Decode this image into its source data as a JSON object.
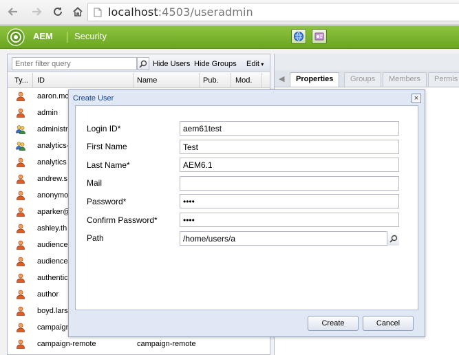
{
  "browser": {
    "url_host": "localhost",
    "url_rest": ":4503/useradmin"
  },
  "header": {
    "product": "AEM",
    "section": "Security"
  },
  "toolbar": {
    "filter_placeholder": "Enter filter query",
    "hide_users": "Hide Users",
    "hide_groups": "Hide Groups",
    "edit": "Edit"
  },
  "columns": {
    "type": "Ty...",
    "id": "ID",
    "name": "Name",
    "pub": "Pub.",
    "mod": "Mod."
  },
  "users": [
    {
      "id": "aaron.mc",
      "name": "",
      "kind": "user"
    },
    {
      "id": "admin",
      "name": "",
      "kind": "user"
    },
    {
      "id": "administr",
      "name": "",
      "kind": "group"
    },
    {
      "id": "analytics-",
      "name": "",
      "kind": "group"
    },
    {
      "id": "analytics",
      "name": "",
      "kind": "user"
    },
    {
      "id": "andrew.s",
      "name": "",
      "kind": "user"
    },
    {
      "id": "anonymo",
      "name": "",
      "kind": "user"
    },
    {
      "id": "aparker@",
      "name": "",
      "kind": "user"
    },
    {
      "id": "ashley.th",
      "name": "",
      "kind": "user"
    },
    {
      "id": "audience",
      "name": "",
      "kind": "user"
    },
    {
      "id": "audience",
      "name": "",
      "kind": "user"
    },
    {
      "id": "authentic",
      "name": "",
      "kind": "user"
    },
    {
      "id": "author",
      "name": "",
      "kind": "user"
    },
    {
      "id": "boyd.lars",
      "name": "",
      "kind": "user"
    },
    {
      "id": "campaign",
      "name": "",
      "kind": "user"
    },
    {
      "id": "campaign-remote",
      "name": "campaign-remote",
      "kind": "user"
    }
  ],
  "tabs": [
    "Properties",
    "Groups",
    "Members",
    "Permis"
  ],
  "dialog": {
    "title": "Create User",
    "labels": {
      "login_id": "Login ID*",
      "first_name": "First Name",
      "last_name": "Last Name*",
      "mail": "Mail",
      "password": "Password*",
      "confirm_password": "Confirm Password*",
      "path": "Path"
    },
    "values": {
      "login_id": "aem61test",
      "first_name": "Test",
      "last_name": "AEM6.1",
      "mail": "",
      "password": "••••",
      "confirm_password": "••••",
      "path": "/home/users/a"
    },
    "create_label": "Create",
    "cancel_label": "Cancel"
  },
  "colors": {
    "header_green": "#7ab52f",
    "dialog_title": "#15428b",
    "user_icon": "#d9602a",
    "group_icon": "#3b8a3e"
  }
}
